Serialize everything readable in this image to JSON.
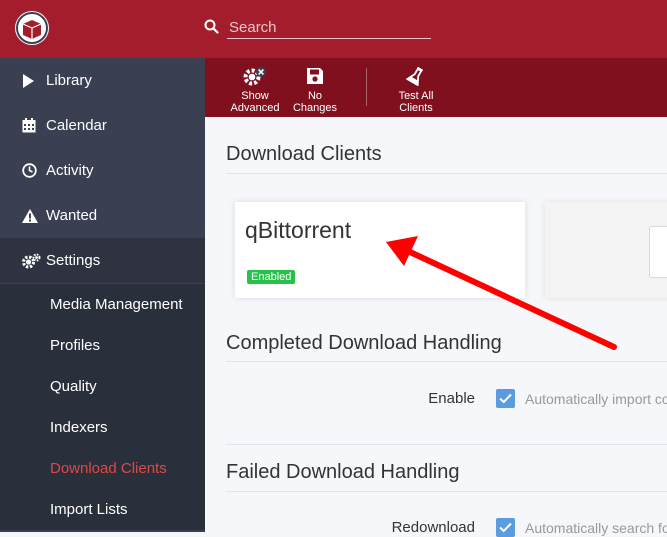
{
  "header": {
    "search": {
      "placeholder": "Search"
    }
  },
  "sidebar": {
    "items": [
      {
        "label": "Library",
        "icon": "play-icon"
      },
      {
        "label": "Calendar",
        "icon": "calendar-icon"
      },
      {
        "label": "Activity",
        "icon": "clock-icon"
      },
      {
        "label": "Wanted",
        "icon": "warning-icon"
      },
      {
        "label": "Settings",
        "icon": "gears-icon"
      }
    ],
    "sub_items": [
      {
        "label": "Media Management"
      },
      {
        "label": "Profiles"
      },
      {
        "label": "Quality"
      },
      {
        "label": "Indexers"
      },
      {
        "label": "Download Clients",
        "current": true
      },
      {
        "label": "Import Lists"
      }
    ]
  },
  "toolbar": {
    "show_advanced": {
      "line1": "Show",
      "line2": "Advanced"
    },
    "no_changes": {
      "line1": "No",
      "line2": "Changes"
    },
    "test_all": {
      "line1": "Test All",
      "line2": "Clients"
    }
  },
  "main": {
    "download_clients_title": "Download Clients",
    "client_card": {
      "name": "qBittorrent",
      "status": "Enabled"
    },
    "completed_title": "Completed Download Handling",
    "enable_label": "Enable",
    "enable_help": "Automatically import co",
    "failed_title": "Failed Download Handling",
    "redownload_label": "Redownload",
    "redownload_help": "Automatically search fo"
  },
  "colors": {
    "header_bg": "#a31d2c",
    "toolbar_bg": "#80101e",
    "sidebar_bg": "#3a3f51",
    "active_link": "#e04845",
    "enabled_badge": "#27c24c",
    "checkbox": "#5b9be0",
    "annotation_arrow": "#ff0000"
  }
}
